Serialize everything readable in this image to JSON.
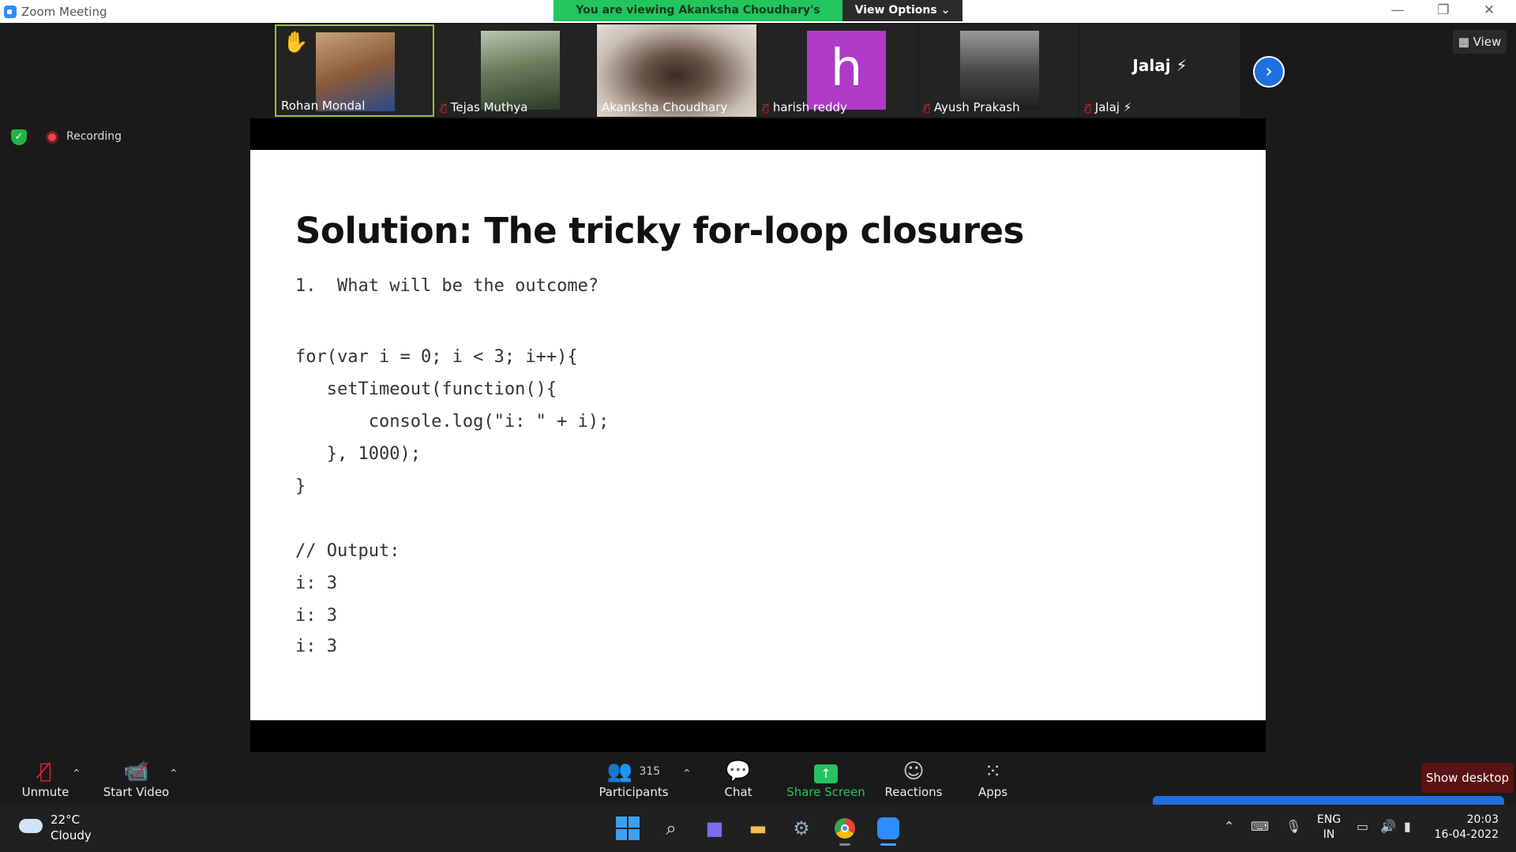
{
  "window": {
    "title": "Zoom Meeting",
    "minimize": "—",
    "restore": "❐",
    "close": "✕"
  },
  "banner": {
    "viewing_text": "You are viewing Akanksha Choudhary's screen",
    "view_options": "View Options ⌄"
  },
  "gallery": {
    "participants": [
      {
        "name": "Rohan Mondal",
        "muted": false,
        "hand_raised": true,
        "active": true
      },
      {
        "name": "Tejas Muthya",
        "muted": true
      },
      {
        "name": "Akanksha Choudhary",
        "muted": false
      },
      {
        "name": "harish reddy",
        "muted": true,
        "avatar_letter": "h",
        "avatar_color": "#b039c8"
      },
      {
        "name": "Ayush Prakash",
        "muted": true
      },
      {
        "name": "Jalaj",
        "muted": true,
        "header": "Jalaj ⚡",
        "suffix": "⚡"
      }
    ],
    "next_icon": "›",
    "view_label": "View"
  },
  "recording": {
    "label": "Recording"
  },
  "slide": {
    "title": "Solution: The tricky for-loop closures",
    "question": "1.  What will be the outcome?",
    "code_lines": [
      "for(var i = 0; i < 3; i++){",
      "   setTimeout(function(){",
      "       console.log(\"i: \" + i);",
      "   }, 1000);",
      "}"
    ],
    "output_header": "// Output:",
    "output_lines": [
      "i: 3",
      "i: 3",
      "i: 3"
    ]
  },
  "toolbar": {
    "unmute": "Unmute",
    "start_video": "Start Video",
    "participants_label": "Participants",
    "participants_count": "315",
    "chat": "Chat",
    "share_screen": "Share Screen",
    "reactions": "Reactions",
    "apps": "Apps",
    "show_desktop": "Show desktop"
  },
  "taskbar": {
    "weather_temp": "22°C",
    "weather_cond": "Cloudy",
    "lang_top": "ENG",
    "lang_bottom": "IN",
    "time": "20:03",
    "date": "16-04-2022"
  },
  "colors": {
    "accent_blue": "#1f6fe0",
    "share_green": "#22c55e",
    "active_border": "#9dc13b",
    "mute_red": "#e0242e"
  }
}
